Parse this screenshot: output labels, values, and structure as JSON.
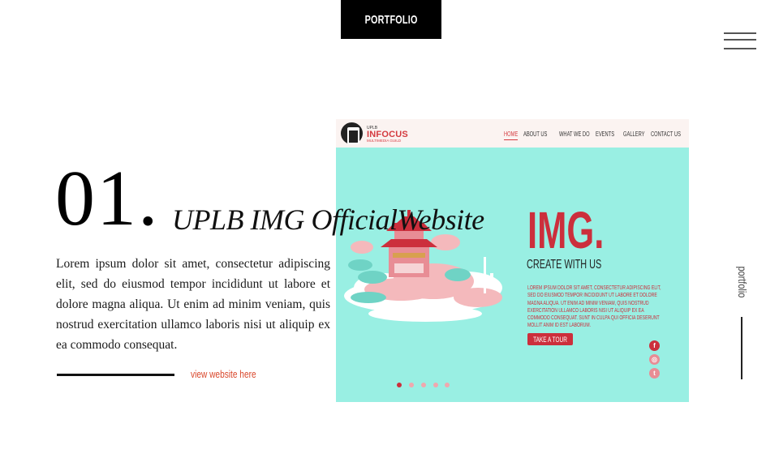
{
  "header": {
    "badge_label": "PORTFOLIO",
    "menu_icon": "hamburger-menu-icon"
  },
  "sidebar": {
    "vertical_label": "portfolio"
  },
  "project": {
    "number": "01.",
    "title": "UPLB IMG OfficialWebsite",
    "description": "Lorem ipsum dolor sit amet, consectetur adipiscing elit, sed do eiusmod tempor incididunt ut labore et dolore magna aliqua. Ut enim ad minim veniam, quis nostrud exercitation ullamco laboris nisi ut aliquip ex ea commodo consequat.",
    "link_label": "view website here"
  },
  "preview": {
    "logo": {
      "small": "UPLB",
      "main": "INFOCUS",
      "sub": "MULTIMEDIA GUILD"
    },
    "nav": [
      "HOME",
      "ABOUT US",
      "WHAT WE DO",
      "EVENTS",
      "GALLERY",
      "CONTACT US"
    ],
    "active_nav": "HOME",
    "hero_title": "IMG.",
    "hero_subtitle": "CREATE WITH US",
    "hero_text": "Lorem ipsum dolor sit amet, consectetur adipiscing elit, sed do eiusmod tempor incididunt ut labore et dolore magna aliqua. Ut enim ad minim veniam, quis nostrud exercitation ullamco laboris nisi ut aliquip ex ea commodo consequat. Sunt in culpa qui officia deserunt mollit anim id est laborum.",
    "cta_label": "TAKE A TOUR",
    "social_icons": [
      "facebook-icon",
      "instagram-icon",
      "twitter-icon"
    ],
    "slider_dots": 5,
    "active_dot": 1,
    "colors": {
      "hero_bg": "#99efe3",
      "accent": "#cc2f3c",
      "nav_bg": "#fbf3f1"
    }
  },
  "colors": {
    "link": "#d9472b",
    "badge_bg": "#000000"
  }
}
